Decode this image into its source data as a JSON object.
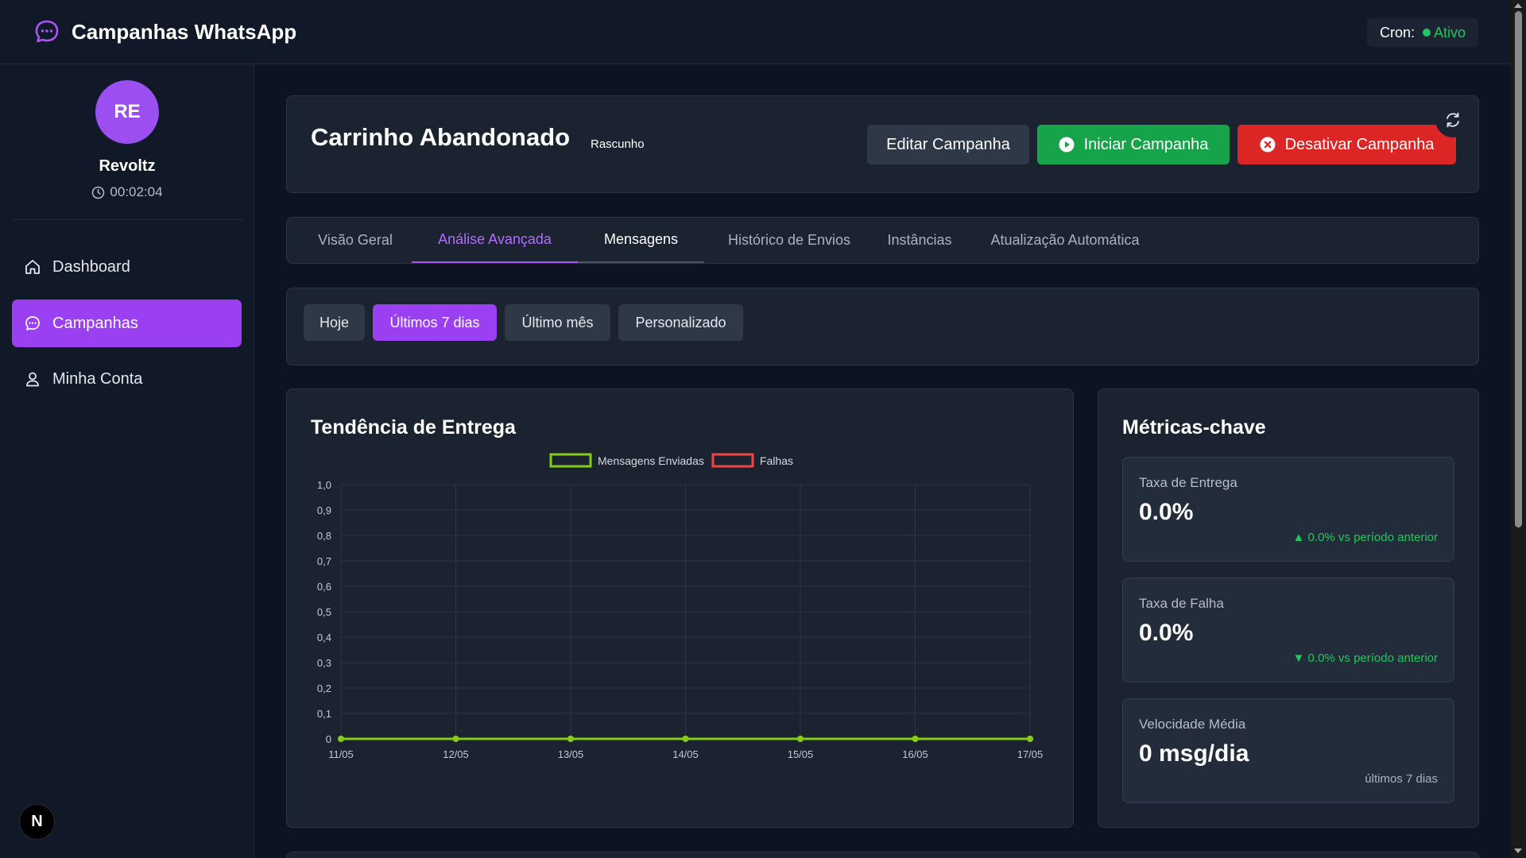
{
  "app": {
    "title": "Campanhas WhatsApp"
  },
  "cron": {
    "label": "Cron:",
    "status": "Ativo",
    "status_color": "#22c55e"
  },
  "user": {
    "initials": "RE",
    "name": "Revoltz",
    "timer": "00:02:04"
  },
  "sidebar": {
    "items": [
      {
        "label": "Dashboard",
        "icon": "home-icon",
        "active": false
      },
      {
        "label": "Campanhas",
        "icon": "chat-bubble-icon",
        "active": true
      },
      {
        "label": "Minha Conta",
        "icon": "user-icon",
        "active": false
      }
    ],
    "footer_badge": "N"
  },
  "campaign": {
    "title": "Carrinho Abandonado",
    "status": "Rascunho",
    "buttons": {
      "edit": "Editar Campanha",
      "start": "Iniciar Campanha",
      "deactivate": "Desativar Campanha"
    }
  },
  "tabs": [
    {
      "label": "Visão Geral"
    },
    {
      "label": "Análise Avançada",
      "active": true
    },
    {
      "label": "Mensagens"
    },
    {
      "label": "Histórico de Envios"
    },
    {
      "label": "Instâncias"
    },
    {
      "label": "Atualização Automática"
    }
  ],
  "range": {
    "options": [
      "Hoje",
      "Últimos 7 dias",
      "Último mês",
      "Personalizado"
    ],
    "selected": "Últimos 7 dias"
  },
  "delivery_chart": {
    "title": "Tendência de Entrega"
  },
  "chart_data": {
    "type": "line",
    "title": "Tendência de Entrega",
    "x": [
      "11/05",
      "12/05",
      "13/05",
      "14/05",
      "15/05",
      "16/05",
      "17/05"
    ],
    "series": [
      {
        "name": "Mensagens Enviadas",
        "values": [
          0,
          0,
          0,
          0,
          0,
          0,
          0
        ],
        "color": "#84cc16"
      },
      {
        "name": "Falhas",
        "values": [
          0,
          0,
          0,
          0,
          0,
          0,
          0
        ],
        "color": "#ef4444"
      }
    ],
    "yticks": [
      "0",
      "0,1",
      "0,2",
      "0,3",
      "0,4",
      "0,5",
      "0,6",
      "0,7",
      "0,8",
      "0,9",
      "1,0"
    ],
    "ylim": [
      0,
      1
    ],
    "grid": true,
    "legend": "top-center"
  },
  "metrics": {
    "title": "Métricas-chave",
    "cards": [
      {
        "label": "Taxa de Entrega",
        "value": "0.0%",
        "delta": "▲ 0.0% vs período anterior"
      },
      {
        "label": "Taxa de Falha",
        "value": "0.0%",
        "delta": "▼ 0.0% vs período anterior"
      },
      {
        "label": "Velocidade Média",
        "value": "0 msg/dia",
        "note": "últimos 7 dias"
      }
    ]
  }
}
